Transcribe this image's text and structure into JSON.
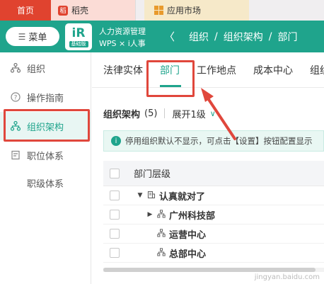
{
  "browser_tabs": [
    {
      "label": "首页"
    },
    {
      "label": "稻壳",
      "logo": "稻"
    },
    {
      "label": "应用市场"
    }
  ],
  "header": {
    "menu_label": "菜单",
    "app_logo_mark": "iR",
    "app_logo_sub": "基础版",
    "app_name_line1": "人力资源管理",
    "app_name_line2": "WPS × i人事",
    "breadcrumb": [
      "组织",
      "/",
      "组织架构",
      "/",
      "部门"
    ]
  },
  "sidebar": {
    "items": [
      {
        "label": "组织",
        "icon": "org-tree-icon"
      },
      {
        "label": "操作指南",
        "icon": "help-circle-icon"
      },
      {
        "label": "组织架构",
        "icon": "org-chart-icon",
        "active": true
      },
      {
        "label": "职位体系",
        "icon": "document-icon"
      },
      {
        "label": "职级体系",
        "icon": ""
      }
    ]
  },
  "tabs": [
    {
      "label": "法律实体"
    },
    {
      "label": "部门",
      "active": true
    },
    {
      "label": "工作地点"
    },
    {
      "label": "成本中心"
    },
    {
      "label": "组织"
    }
  ],
  "toolbar": {
    "title": "组织架构",
    "count": "(5)",
    "expand_label": "展开1级"
  },
  "notice": {
    "text": "停用组织默认不显示，可点击【设置】按钮配置显示"
  },
  "table": {
    "header": "部门层级",
    "rows": [
      {
        "name": "认真就对了",
        "level": 0,
        "expanded": true
      },
      {
        "name": "广州科技部",
        "level": 1,
        "expanded": false
      },
      {
        "name": "运营中心",
        "level": 1
      },
      {
        "name": "总部中心",
        "level": 1
      }
    ]
  },
  "colors": {
    "brand": "#1fa48c",
    "highlight": "#e0473c",
    "home_tab": "#e0432f"
  },
  "watermark": "jingyan.baidu.com"
}
